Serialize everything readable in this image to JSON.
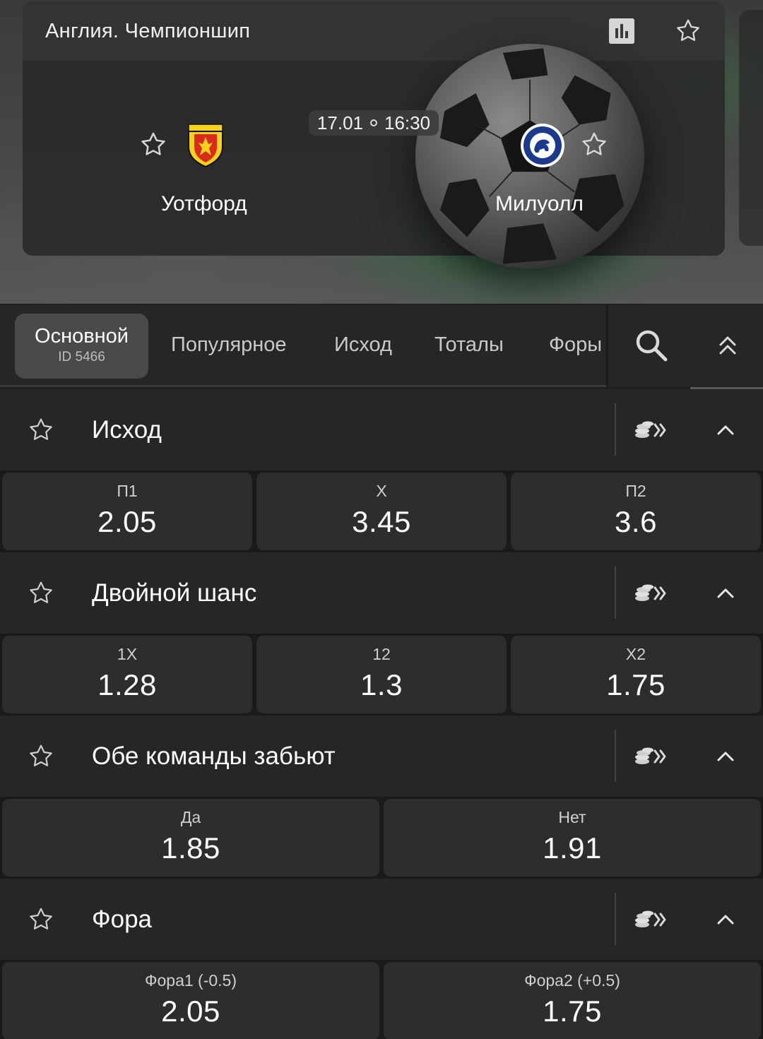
{
  "event": {
    "league": "Англия. Чемпионшип",
    "date": "17.01",
    "time": "16:30",
    "home_team": "Уотфорд",
    "away_team": "Милуолл",
    "home_logo": "watford-crest",
    "away_logo": "millwall-crest"
  },
  "tabs": {
    "active_label": "Основной",
    "active_id": "ID 5466",
    "items": [
      "Популярное",
      "Исход",
      "Тоталы",
      "Форы"
    ]
  },
  "markets": [
    {
      "title": "Исход",
      "odds": [
        {
          "label": "П1",
          "value": "2.05"
        },
        {
          "label": "X",
          "value": "3.45"
        },
        {
          "label": "П2",
          "value": "3.6"
        }
      ]
    },
    {
      "title": "Двойной шанс",
      "odds": [
        {
          "label": "1X",
          "value": "1.28"
        },
        {
          "label": "12",
          "value": "1.3"
        },
        {
          "label": "X2",
          "value": "1.75"
        }
      ]
    },
    {
      "title": "Обе команды забьют",
      "odds": [
        {
          "label": "Да",
          "value": "1.85"
        },
        {
          "label": "Нет",
          "value": "1.91"
        }
      ]
    },
    {
      "title": "Фора",
      "odds": [
        {
          "label": "Фора1 (-0.5)",
          "value": "2.05"
        },
        {
          "label": "Фора2 (+0.5)",
          "value": "1.75"
        }
      ]
    }
  ],
  "colors": {
    "background": "#1f1f1f",
    "panel": "#262626",
    "odd_tile": "#2d2d2d",
    "active_tab": "#4a4a4a",
    "hero_green": "#286e3c"
  }
}
